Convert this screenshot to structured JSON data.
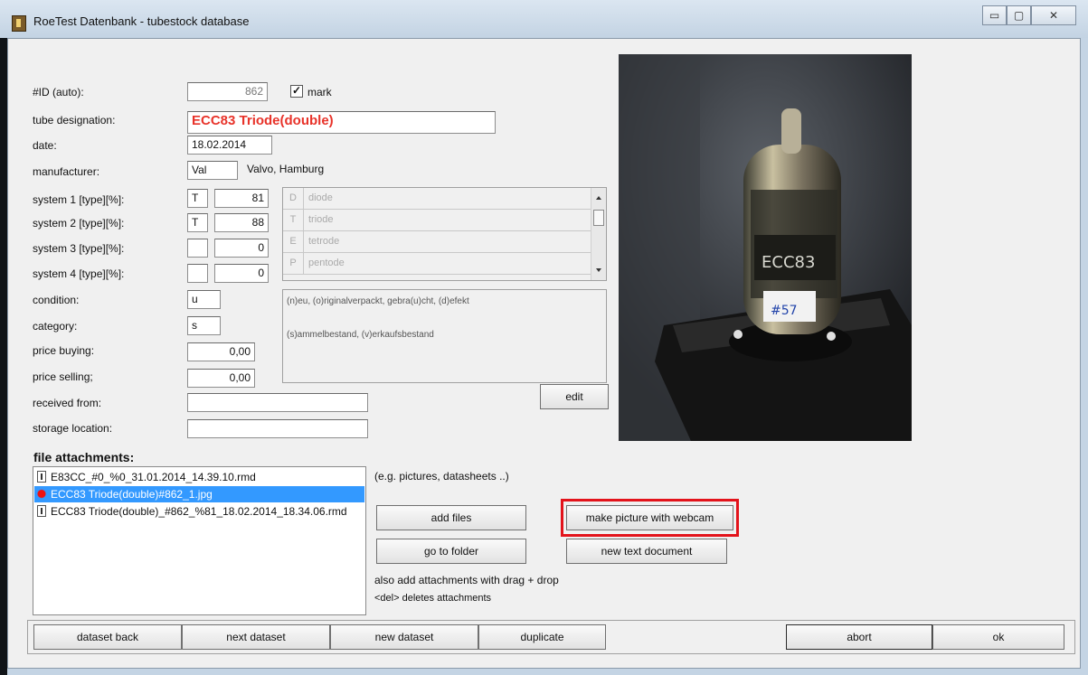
{
  "window": {
    "title": "RoeTest Datenbank - tubestock database",
    "controls": {
      "minimize": "▭",
      "maximize": "▢",
      "close": "✕"
    }
  },
  "form": {
    "id": {
      "label": "#ID (auto):",
      "value": "862"
    },
    "mark": {
      "label": "mark",
      "checked": true,
      "check_glyph": "✓"
    },
    "tube_designation": {
      "label": "tube designation:",
      "value": "ECC83 Triode(double)"
    },
    "date": {
      "label": "date:",
      "value": "18.02.2014"
    },
    "manufacturer": {
      "label": "manufacturer:",
      "code": "Val",
      "name": "Valvo, Hamburg"
    },
    "systems": [
      {
        "label": "system 1 [type][%]:",
        "type": "T",
        "percent": "81"
      },
      {
        "label": "system 2 [type][%]:",
        "type": "T",
        "percent": "88"
      },
      {
        "label": "system 3 [type][%]:",
        "type": "",
        "percent": "0"
      },
      {
        "label": "system 4 [type][%]:",
        "type": "",
        "percent": "0"
      }
    ],
    "system_types": [
      {
        "code": "D",
        "name": "diode"
      },
      {
        "code": "T",
        "name": "triode"
      },
      {
        "code": "E",
        "name": "tetrode"
      },
      {
        "code": "P",
        "name": "pentode"
      }
    ],
    "condition": {
      "label": "condition:",
      "value": "u"
    },
    "category": {
      "label": "category:",
      "value": "s"
    },
    "price_buying": {
      "label": "price buying:",
      "value": "0,00"
    },
    "price_selling": {
      "label": "price selling;",
      "value": "0,00"
    },
    "received_from": {
      "label": "received from:",
      "value": ""
    },
    "storage_location": {
      "label": "storage location:",
      "value": ""
    },
    "hints": {
      "condition": "(n)eu, (o)riginalverpackt, gebra(u)cht, (d)efekt",
      "category": "(s)ammelbestand, (v)erkaufsbestand"
    },
    "edit_button": "edit"
  },
  "attachments": {
    "title": "file attachments:",
    "hint": "(e.g. pictures, datasheets ..)",
    "files": [
      {
        "name": "E83CC_#0_%0_31.01.2014_14.39.10.rmd",
        "icon": "document-icon",
        "selected": false
      },
      {
        "name": "ECC83 Triode(double)#862_1.jpg",
        "icon": "image-icon",
        "selected": true
      },
      {
        "name": "ECC83 Triode(double)_#862_%81_18.02.2014_18.34.06.rmd",
        "icon": "document-icon",
        "selected": false
      }
    ],
    "buttons": {
      "add_files": "add files",
      "make_picture": "make picture with webcam",
      "go_to_folder": "go to folder",
      "new_text_document": "new text document"
    },
    "drag_hint": "also add attachments with drag + drop",
    "delete_hint": "<del> deletes attachments"
  },
  "photo": {
    "label_text": "ECC83",
    "sticker_text": "#57"
  },
  "footer": {
    "dataset_back": "dataset back",
    "next_dataset": "next dataset",
    "new_dataset": "new dataset",
    "duplicate": "duplicate",
    "abort": "abort",
    "ok": "ok"
  }
}
